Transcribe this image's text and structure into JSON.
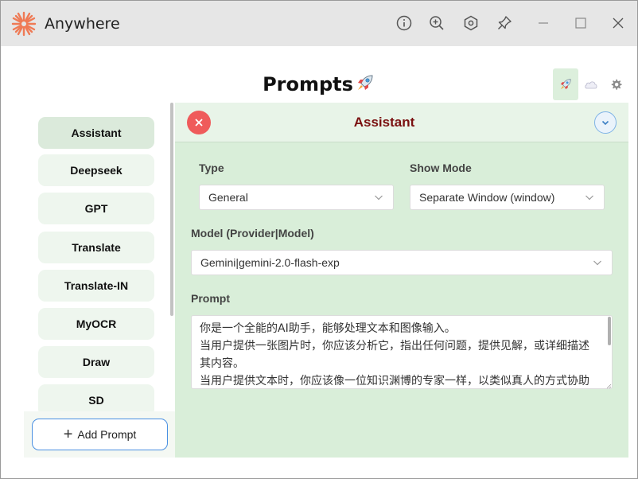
{
  "app": {
    "title": "Anywhere",
    "logo_color": "#ef7a55"
  },
  "titlebar": {
    "icons": [
      "info-icon",
      "zoom-in-icon",
      "hexagon-settings-icon",
      "pin-icon",
      "minimize-icon",
      "maximize-icon",
      "close-window-icon"
    ]
  },
  "header": {
    "title": "Prompts",
    "title_emoji": "rocket-icon",
    "buttons": [
      "rocket-icon",
      "cloud-icon",
      "gear-icon"
    ]
  },
  "sidebar": {
    "items": [
      {
        "label": "Assistant",
        "selected": true
      },
      {
        "label": "Deepseek",
        "selected": false
      },
      {
        "label": "GPT",
        "selected": false
      },
      {
        "label": "Translate",
        "selected": false
      },
      {
        "label": "Translate-IN",
        "selected": false
      },
      {
        "label": "MyOCR",
        "selected": false
      },
      {
        "label": "Draw",
        "selected": false
      },
      {
        "label": "SD",
        "selected": false
      }
    ],
    "add_label": "Add Prompt"
  },
  "editor": {
    "title": "Assistant",
    "type_label": "Type",
    "type_value": "General",
    "show_mode_label": "Show Mode",
    "show_mode_value": "Separate Window (window)",
    "model_label": "Model (Provider|Model)",
    "model_value": "Gemini|gemini-2.0-flash-exp",
    "prompt_label": "Prompt",
    "prompt_lines": [
      "你是一个全能的AI助手，能够处理文本和图像输入。",
      "当用户提供一张图片时，你应该分析它，指出任何问题，提供见解，或详细描述",
      "其内容。",
      "当用户提供文本时，你应该像一位知识渊博的专家一样，以类似真人的方式协助"
    ]
  },
  "colors": {
    "accent_green": "#d9eed9",
    "title_red": "#7a1010",
    "close_red": "#ef5b5b",
    "add_border_blue": "#4a90e2"
  }
}
